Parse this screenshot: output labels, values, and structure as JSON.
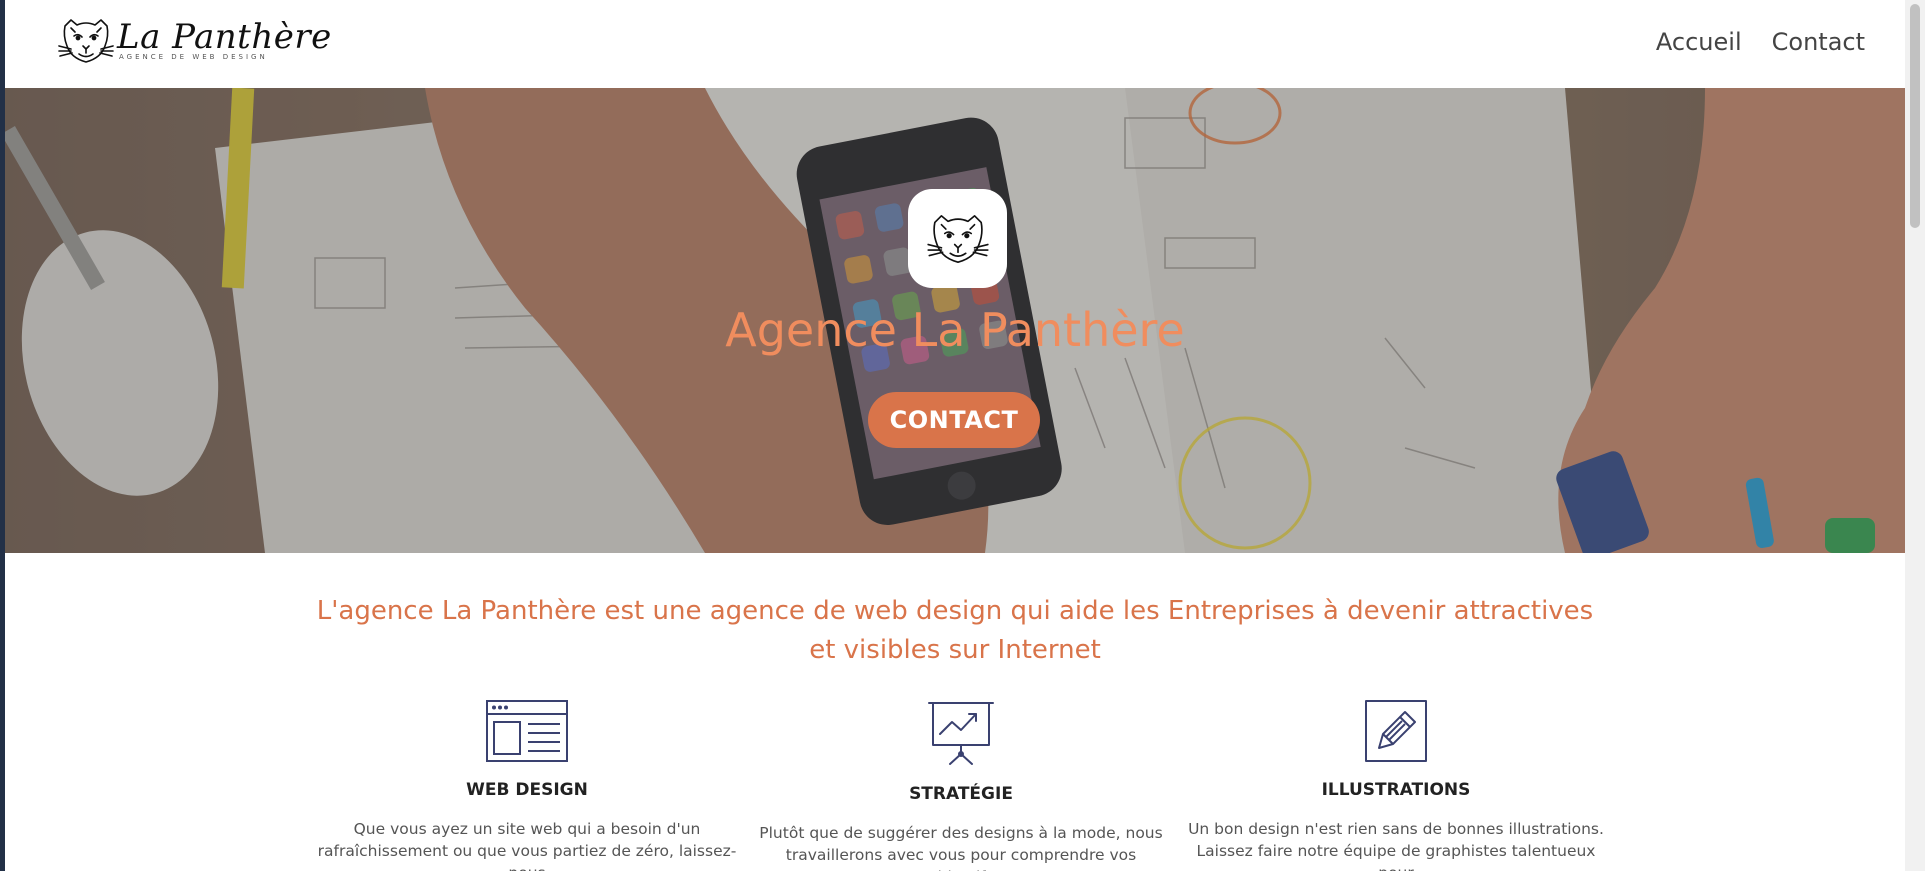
{
  "header": {
    "brand_name": "La Panthère",
    "brand_tagline": "AGENCE DE WEB DESIGN",
    "logo_icon": "panther-logo-icon",
    "nav": [
      {
        "label": "Accueil"
      },
      {
        "label": "Contact"
      }
    ]
  },
  "hero": {
    "logo_icon": "panther-logo-icon",
    "title": "Agence La Panthère",
    "cta_label": "CONTACT"
  },
  "intro": {
    "text": "L'agence La Panthère est une agence de web design qui aide les Entreprises à devenir attractives et visibles sur Internet"
  },
  "services": [
    {
      "icon": "browser-layout-icon",
      "title": "WEB DESIGN",
      "text_line1": "Que vous ayez un site web qui a besoin d'un",
      "text_line2": "rafraîchissement ou que vous partiez de zéro, laissez-nous"
    },
    {
      "icon": "presentation-chart-icon",
      "title": "STRATÉGIE",
      "text_line1": "Plutôt que de suggérer des designs à la mode, nous",
      "text_line2": "travaillerons avec vous pour comprendre vos objectifs"
    },
    {
      "icon": "pencil-edit-icon",
      "title": "ILLUSTRATIONS",
      "text_line1": "Un bon design n'est rien sans de bonnes illustrations.",
      "text_line2": "Laissez faire notre équipe de graphistes talentueux pour"
    }
  ],
  "colors": {
    "accent": "#d9744a",
    "hero_title": "#f08d5e",
    "icon_stroke": "#3a4170",
    "nav_text": "#444444"
  }
}
